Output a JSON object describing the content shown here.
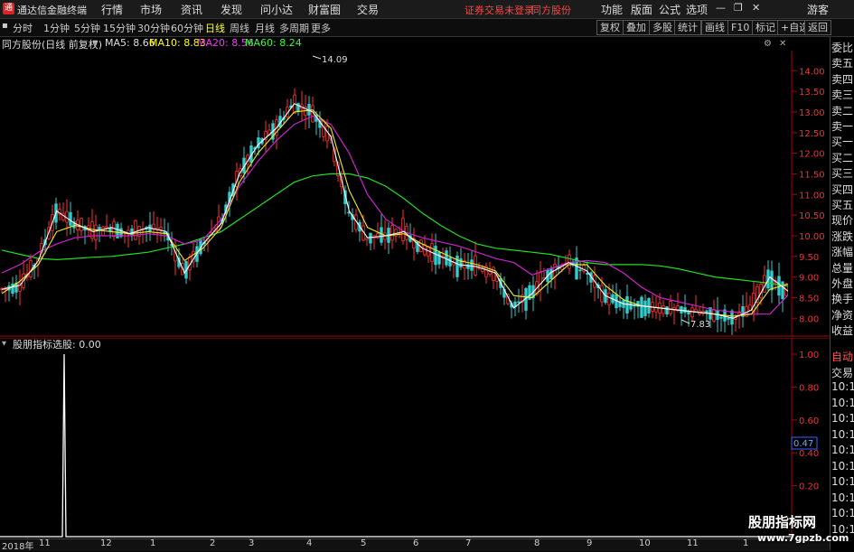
{
  "app": {
    "title": "通达信金融终端",
    "menu": [
      "行情",
      "市场",
      "资讯",
      "发现",
      "问小达",
      "财富圈",
      "交易"
    ],
    "warning": "证券交易未登录",
    "stock_name": "同方股份",
    "right_menu": [
      "功能",
      "版面",
      "公式",
      "选项"
    ],
    "guest": "游客"
  },
  "periods": [
    "分时",
    "1分钟",
    "5分钟",
    "15分钟",
    "30分钟",
    "60分钟",
    "日线",
    "周线",
    "月线",
    "多周期",
    "更多"
  ],
  "active_period": "日线",
  "toolbar": [
    "复权",
    "叠加",
    "多股",
    "统计",
    "画线",
    "F10",
    "标记",
    "+自选",
    "返回"
  ],
  "main_title": "同方股份(日线 前复权)",
  "ma": [
    {
      "label": "MA5: 8.66",
      "color": "#ffffff"
    },
    {
      "label": "MA10: 8.83",
      "color": "#ffff00"
    },
    {
      "label": "MA20: 8.56",
      "color": "#ff33ff"
    },
    {
      "label": "MA60: 8.24",
      "color": "#33ff33"
    }
  ],
  "high_label": "14.09",
  "low_label": "7.83",
  "price_axis": [
    "14.00",
    "13.50",
    "13.00",
    "12.50",
    "12.00",
    "11.50",
    "11.00",
    "10.50",
    "10.00",
    "9.50",
    "9.00",
    "8.50",
    "8.00"
  ],
  "indicator": {
    "name": "股朋指标",
    "value_label": "选股: 0.00"
  },
  "indicator_axis": [
    "1.00",
    "0.80",
    "0.60",
    "0.40",
    "0.20"
  ],
  "indicator_cursor": "0.47",
  "months": [
    "2018年",
    "11",
    "12",
    "1",
    "2",
    "3",
    "4",
    "5",
    "6",
    "7",
    "8",
    "9",
    "10",
    "11",
    "1"
  ],
  "right_panel_top": [
    "委比",
    "卖五",
    "卖四",
    "卖三",
    "卖二",
    "卖一",
    "买一",
    "买二",
    "买三",
    "买四",
    "买五",
    "现价",
    "涨跌",
    "涨幅",
    "总量",
    "外盘",
    "换手",
    "净资",
    "收益"
  ],
  "right_panel_bottom": [
    "自动",
    "交易",
    "10:11",
    "10:11",
    "10:11",
    "10:11",
    "10:11",
    "10:11",
    "10:11",
    "10:11",
    "10:11",
    "10:11"
  ],
  "watermark": {
    "line1": "股朋指标网",
    "line2": "www.7gpzb.com"
  },
  "chart_data": {
    "type": "line",
    "y_range": [
      7.7,
      14.4
    ],
    "ma60": [
      9.65,
      9.55,
      9.45,
      9.42,
      9.45,
      9.48,
      9.5,
      9.55,
      9.6,
      9.7,
      9.8,
      9.95,
      10.1,
      10.4,
      10.7,
      11.0,
      11.3,
      11.45,
      11.5,
      11.5,
      11.4,
      11.2,
      10.9,
      10.55,
      10.25,
      10.0,
      9.8,
      9.7,
      9.65,
      9.6,
      9.55,
      9.45,
      9.35,
      9.3,
      9.3,
      9.3,
      9.27,
      9.2,
      9.1,
      9.0,
      8.95,
      8.9,
      8.85,
      8.78
    ],
    "ma20": [
      9.1,
      9.3,
      9.6,
      9.8,
      9.95,
      10.0,
      10.0,
      10.0,
      10.05,
      10.0,
      9.8,
      9.9,
      10.4,
      11.2,
      11.8,
      12.3,
      12.7,
      12.9,
      12.7,
      12.0,
      11.0,
      10.4,
      10.1,
      9.95,
      9.85,
      9.75,
      9.6,
      9.45,
      9.35,
      9.05,
      9.2,
      9.35,
      9.4,
      9.35,
      9.1,
      8.75,
      8.5,
      8.4,
      8.3,
      8.2,
      8.15,
      8.1,
      8.1,
      8.56
    ],
    "ma5": [
      8.7,
      8.8,
      9.4,
      10.6,
      10.3,
      10.1,
      10.2,
      10.05,
      10.2,
      10.1,
      9.1,
      9.8,
      10.3,
      11.5,
      12.2,
      12.6,
      13.2,
      13.0,
      12.4,
      10.6,
      9.95,
      10.0,
      10.1,
      9.7,
      9.5,
      9.3,
      9.25,
      9.1,
      8.25,
      8.6,
      9.1,
      9.35,
      9.15,
      8.55,
      8.35,
      8.3,
      8.25,
      8.2,
      8.15,
      8.1,
      8.0,
      8.2,
      9.0,
      8.66
    ],
    "ma10": [
      8.6,
      8.9,
      9.3,
      10.1,
      10.25,
      10.15,
      10.1,
      10.05,
      10.1,
      10.05,
      9.4,
      9.7,
      10.2,
      11.3,
      12.0,
      12.5,
      13.0,
      13.05,
      12.6,
      11.1,
      10.2,
      10.0,
      10.05,
      9.8,
      9.6,
      9.4,
      9.3,
      9.15,
      8.55,
      8.5,
      8.9,
      9.3,
      9.3,
      8.8,
      8.45,
      8.3,
      8.25,
      8.2,
      8.15,
      8.1,
      8.05,
      8.1,
      8.7,
      8.83
    ],
    "indicator_pulse_x": "2018-11 (early)",
    "indicator_pulse_value": 1.0
  }
}
